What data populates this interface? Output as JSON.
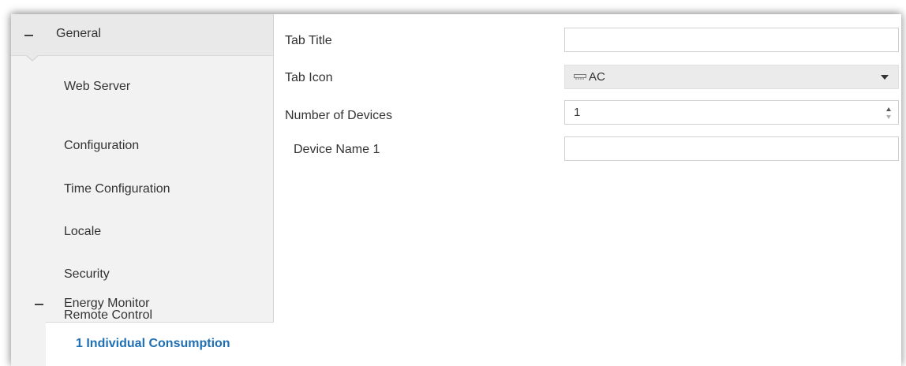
{
  "sidebar": {
    "header": {
      "label": "General",
      "icon": "minus-icon"
    },
    "items": [
      {
        "label": "Web Server"
      },
      {
        "label": "Configuration"
      },
      {
        "label": "Time Configuration"
      },
      {
        "label": "Locale"
      },
      {
        "label": "Security"
      },
      {
        "label": "Remote Control"
      }
    ],
    "group": {
      "label": "Energy Monitor",
      "icon": "minus-icon"
    },
    "selected": {
      "label": "1 Individual Consumption",
      "color": "#1f6fb4"
    }
  },
  "form": {
    "tab_title": {
      "label": "Tab Title",
      "value": ""
    },
    "tab_icon": {
      "label": "Tab Icon",
      "value": "AC",
      "icon": "ac-unit-icon"
    },
    "num_devices": {
      "label": "Number of Devices",
      "value": "1"
    },
    "device_name_1": {
      "label": "Device Name 1",
      "value": ""
    }
  }
}
